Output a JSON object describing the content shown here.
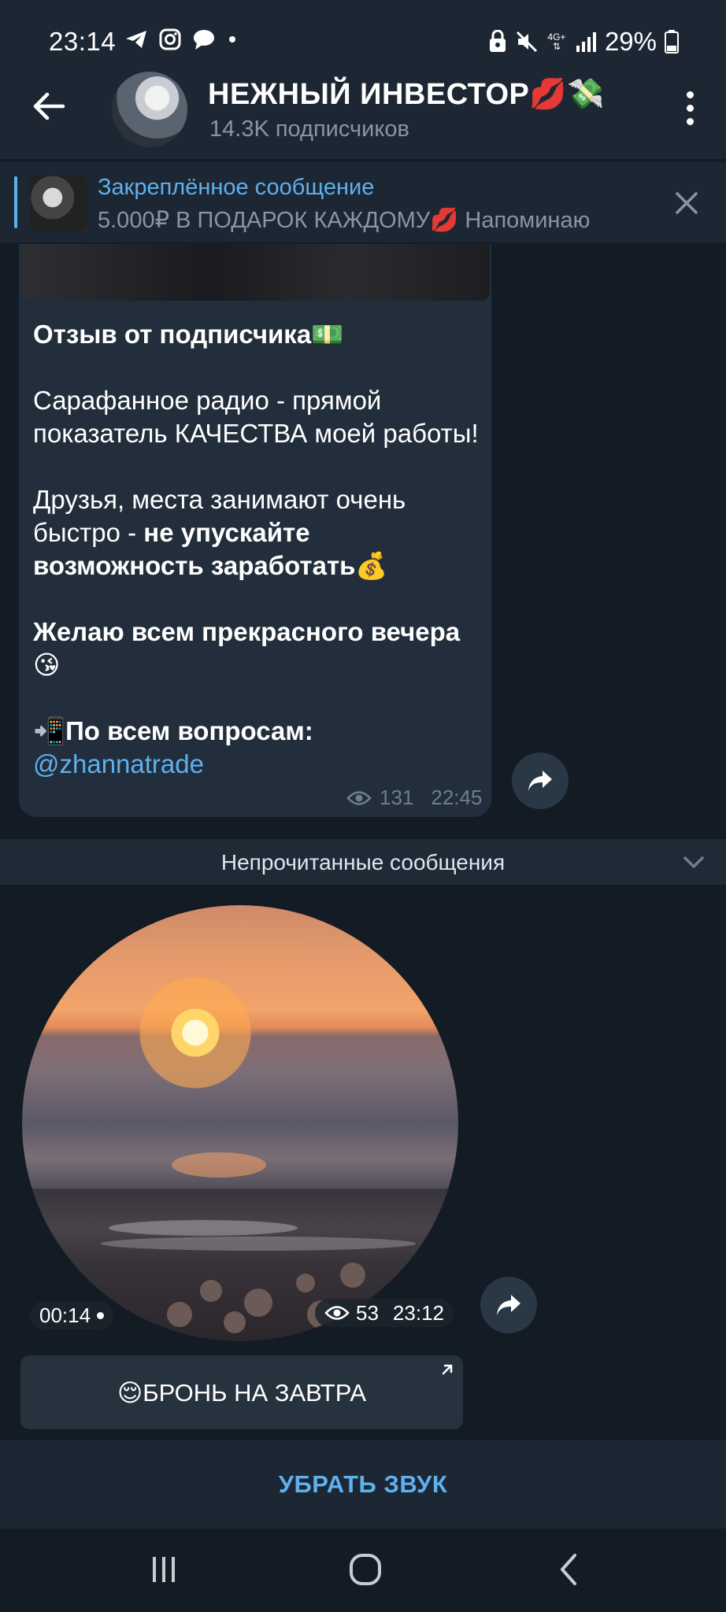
{
  "status_bar": {
    "time": "23:14",
    "battery": "29%",
    "net_top": "4G+",
    "icons": [
      "telegram-icon",
      "instagram-icon",
      "chat-icon",
      "dot-icon",
      "lock-icon",
      "mute-icon",
      "network-icon",
      "signal-icon",
      "battery-icon"
    ]
  },
  "header": {
    "title": "НЕЖНЫЙ ИНВЕСТОР💋💸",
    "subtitle": "14.3K подписчиков"
  },
  "pinned": {
    "title": "Закреплённое сообщение",
    "text": "5.000₽ В ПОДАРОК КАЖДОМУ💋  Напоминаю"
  },
  "message": {
    "heading": "Отзыв от подписчика💵",
    "p1": "Сарафанное радио - прямой показатель КАЧЕСТВА моей работы!",
    "p2_normal": "Друзья, места занимают очень быстро - ",
    "p2_bold": "не упускайте возможность заработать💰",
    "p3": "Желаю всем прекрасного вечера 😘",
    "p4": "📲По всем вопросам:",
    "link": "@zhannatrade",
    "views": "131",
    "time": "22:45"
  },
  "unread": {
    "label": "Непрочитанные сообщения"
  },
  "video_message": {
    "duration": "00:14",
    "views": "53",
    "time": "23:12"
  },
  "inline_button": {
    "label": "😌БРОНЬ НА ЗАВТРА"
  },
  "bottom_action": {
    "label": "УБРАТЬ ЗВУК"
  },
  "colors": {
    "accent": "#5eb0ef",
    "bubble": "#222e3b",
    "header": "#1d2733",
    "background": "#131b24"
  }
}
